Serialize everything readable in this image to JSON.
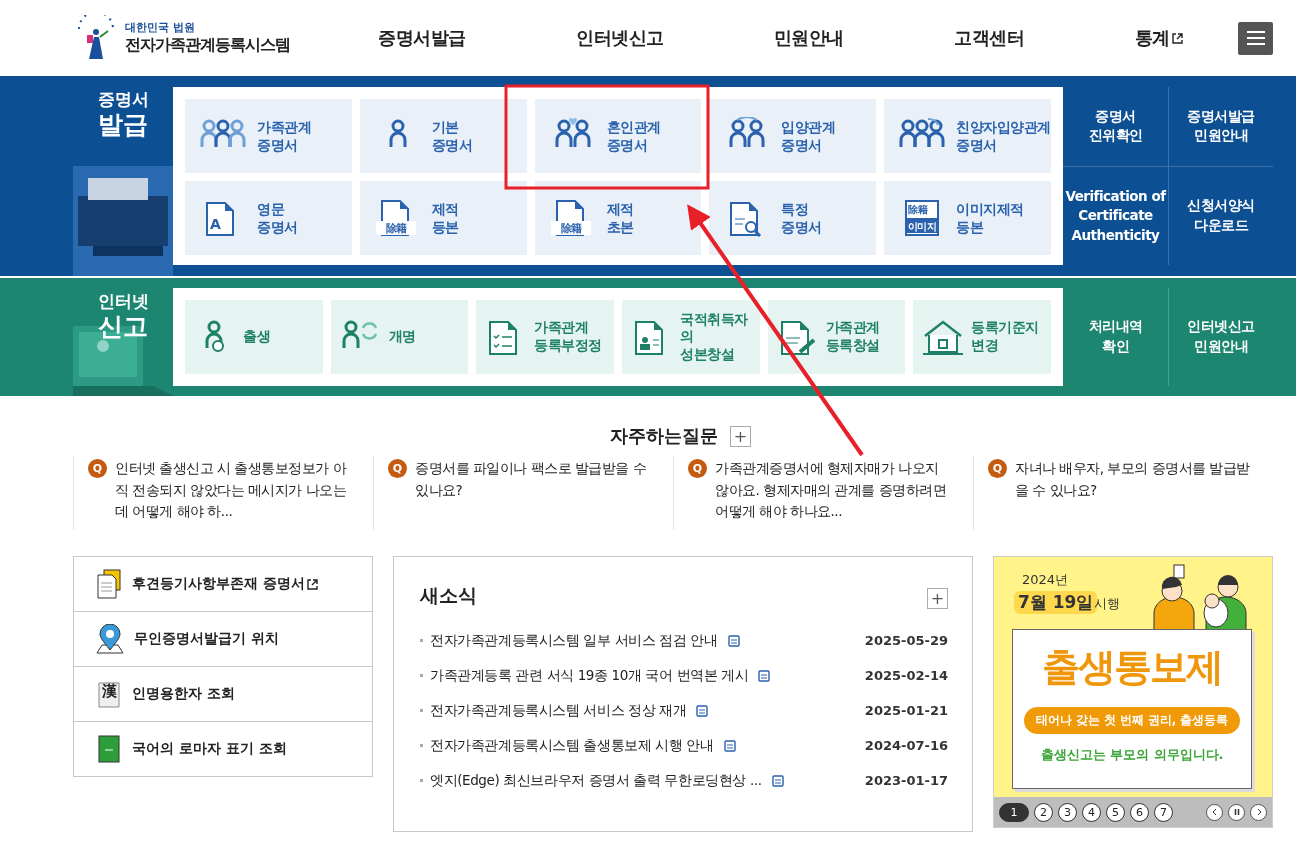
{
  "header": {
    "org": "대한민국 법원",
    "title": "전자가족관계등록시스템",
    "nav": [
      {
        "label": "증명서발급",
        "external": false
      },
      {
        "label": "인터넷신고",
        "external": false
      },
      {
        "label": "민원안내",
        "external": false
      },
      {
        "label": "고객센터",
        "external": false
      },
      {
        "label": "통계",
        "external": true
      }
    ]
  },
  "certificate": {
    "heading": [
      "증명서",
      "발급"
    ],
    "tiles": [
      {
        "kind": "family",
        "lines": [
          "가족관계",
          "증명서"
        ]
      },
      {
        "kind": "person",
        "lines": [
          "기본",
          "증명서"
        ]
      },
      {
        "kind": "couple",
        "lines": [
          "혼인관계",
          "증명서"
        ]
      },
      {
        "kind": "adoption",
        "lines": [
          "입양관계",
          "증명서"
        ]
      },
      {
        "kind": "family-adoption",
        "lines": [
          "친양자입양관계",
          "증명서"
        ]
      },
      {
        "kind": "doc-a",
        "lines": [
          "영문",
          "증명서"
        ],
        "icon_text": "A"
      },
      {
        "kind": "doc-stamp",
        "lines": [
          "제적",
          "등본"
        ],
        "icon_text": "除籍"
      },
      {
        "kind": "doc-stamp",
        "lines": [
          "제적",
          "초본"
        ],
        "icon_text": "除籍"
      },
      {
        "kind": "doc-search",
        "lines": [
          "특정",
          "증명서"
        ]
      },
      {
        "kind": "doc-image",
        "lines": [
          "이미지제적",
          "등본"
        ],
        "icon_text": "이미지",
        "icon_subtext": "除籍"
      }
    ],
    "side_links": [
      [
        "증명서",
        "진위확인"
      ],
      [
        "증명서발급",
        "민원안내"
      ],
      [
        "Verification of",
        "Certificate",
        "Authenticity"
      ],
      [
        "신청서양식",
        "다운로드"
      ]
    ]
  },
  "report": {
    "heading": [
      "인터넷",
      "신고"
    ],
    "tiles": [
      {
        "kind": "birth",
        "lines": [
          "출생"
        ]
      },
      {
        "kind": "rename",
        "lines": [
          "개명"
        ]
      },
      {
        "kind": "doc-check",
        "lines": [
          "가족관계",
          "등록부정정"
        ]
      },
      {
        "kind": "doc-person",
        "lines": [
          "국적취득자의",
          "성본창설"
        ]
      },
      {
        "kind": "doc-pen",
        "lines": [
          "가족관계",
          "등록창설"
        ]
      },
      {
        "kind": "house",
        "lines": [
          "등록기준지",
          "변경"
        ]
      }
    ],
    "side_links": [
      [
        "처리내역",
        "확인"
      ],
      [
        "인터넷신고",
        "민원안내"
      ]
    ]
  },
  "faq": {
    "title": "자주하는질문",
    "more": "+",
    "items": [
      {
        "badge": "Q",
        "text": "인터넷 출생신고 시 출생통보정보가 아직 전송되지 않았다는 메시지가 나오는데 어떻게 해야 하..."
      },
      {
        "badge": "Q",
        "text": "증명서를 파일이나 팩스로 발급받을 수 있나요?"
      },
      {
        "badge": "Q",
        "text": "가족관계증명서에 형제자매가 나오지 않아요. 형제자매의 관계를 증명하려면 어떻게 해야 하나요..."
      },
      {
        "badge": "Q",
        "text": "자녀나 배우자, 부모의 증명서를 발급받을 수 있나요?"
      }
    ]
  },
  "quick_links": [
    {
      "kind": "document",
      "label": "후견등기사항부존재 증명서",
      "external": true
    },
    {
      "kind": "location",
      "label": "무인증명서발급기 위치",
      "external": false
    },
    {
      "kind": "hanja",
      "label": "인명용한자 조회",
      "external": false,
      "icon_text": "漢"
    },
    {
      "kind": "book",
      "label": "국어의 로마자 표기 조회",
      "external": false
    }
  ],
  "news": {
    "title": "새소식",
    "more": "+",
    "items": [
      {
        "title": "전자가족관계등록시스템 일부 서비스 점검 안내",
        "date": "2025-05-29"
      },
      {
        "title": "가족관계등록 관련 서식 19종 10개 국어 번역본 게시",
        "date": "2025-02-14"
      },
      {
        "title": "전자가족관계등록시스템 서비스 정상 재개",
        "date": "2025-01-21"
      },
      {
        "title": "전자가족관계등록시스템 출생통보제 시행 안내",
        "date": "2024-07-16"
      },
      {
        "title": "엣지(Edge) 최신브라우저 증명서 출력 무한로딩현상 ...",
        "date": "2023-01-17"
      }
    ]
  },
  "banner": {
    "year": "2024년",
    "date": "7월 19일",
    "suffix": "시행",
    "headline": "출생통보제",
    "pill": "태어나 갖는 첫 번째 권리, 출생등록",
    "footer": "출생신고는 부모의 의무입니다.",
    "pages": [
      {
        "label": "1",
        "selected": true
      },
      {
        "label": "2",
        "selected": false
      },
      {
        "label": "3",
        "selected": false
      },
      {
        "label": "4",
        "selected": false
      },
      {
        "label": "5",
        "selected": false
      },
      {
        "label": "6",
        "selected": false
      },
      {
        "label": "7",
        "selected": false
      }
    ]
  }
}
